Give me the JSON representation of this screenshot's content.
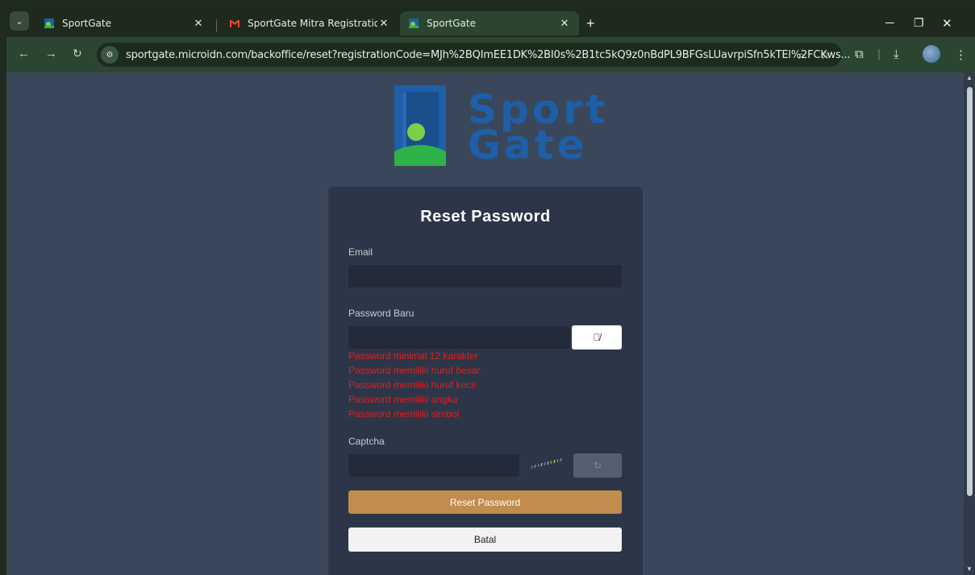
{
  "browser": {
    "tabs": [
      {
        "title": "SportGate",
        "close": "✕",
        "active": false
      },
      {
        "title": "SportGate Mitra Registration - ",
        "close": "✕",
        "active": false
      },
      {
        "title": "SportGate",
        "close": "✕",
        "active": true
      }
    ],
    "new_tab": "+",
    "url": "sportgate.microidn.com/backoffice/reset?registrationCode=MJh%2BQImEE1DK%2BI0s%2B1tc5kQ9z0nBdPL9BFGsLUavrpiSfn5kTEl%2FCKws...",
    "accent_color": "#2c4530"
  },
  "logo": {
    "line1": "Sport",
    "line2": "Gate"
  },
  "form": {
    "title": "Reset Password",
    "email_label": "Email",
    "email_value": "",
    "password_label": "Password Baru",
    "password_value": "",
    "errors": [
      "Password minimal 12 karakter",
      "Password memiliki huruf besar",
      "Password memiliki huruf kecil",
      "Password memiliki angka",
      "Password memiliki simbol"
    ],
    "captcha_label": "Captcha",
    "captcha_value": "",
    "submit_label": "Reset Password",
    "cancel_label": "Batal",
    "submit_color": "#c18c4c",
    "error_color": "#e41d1d"
  }
}
